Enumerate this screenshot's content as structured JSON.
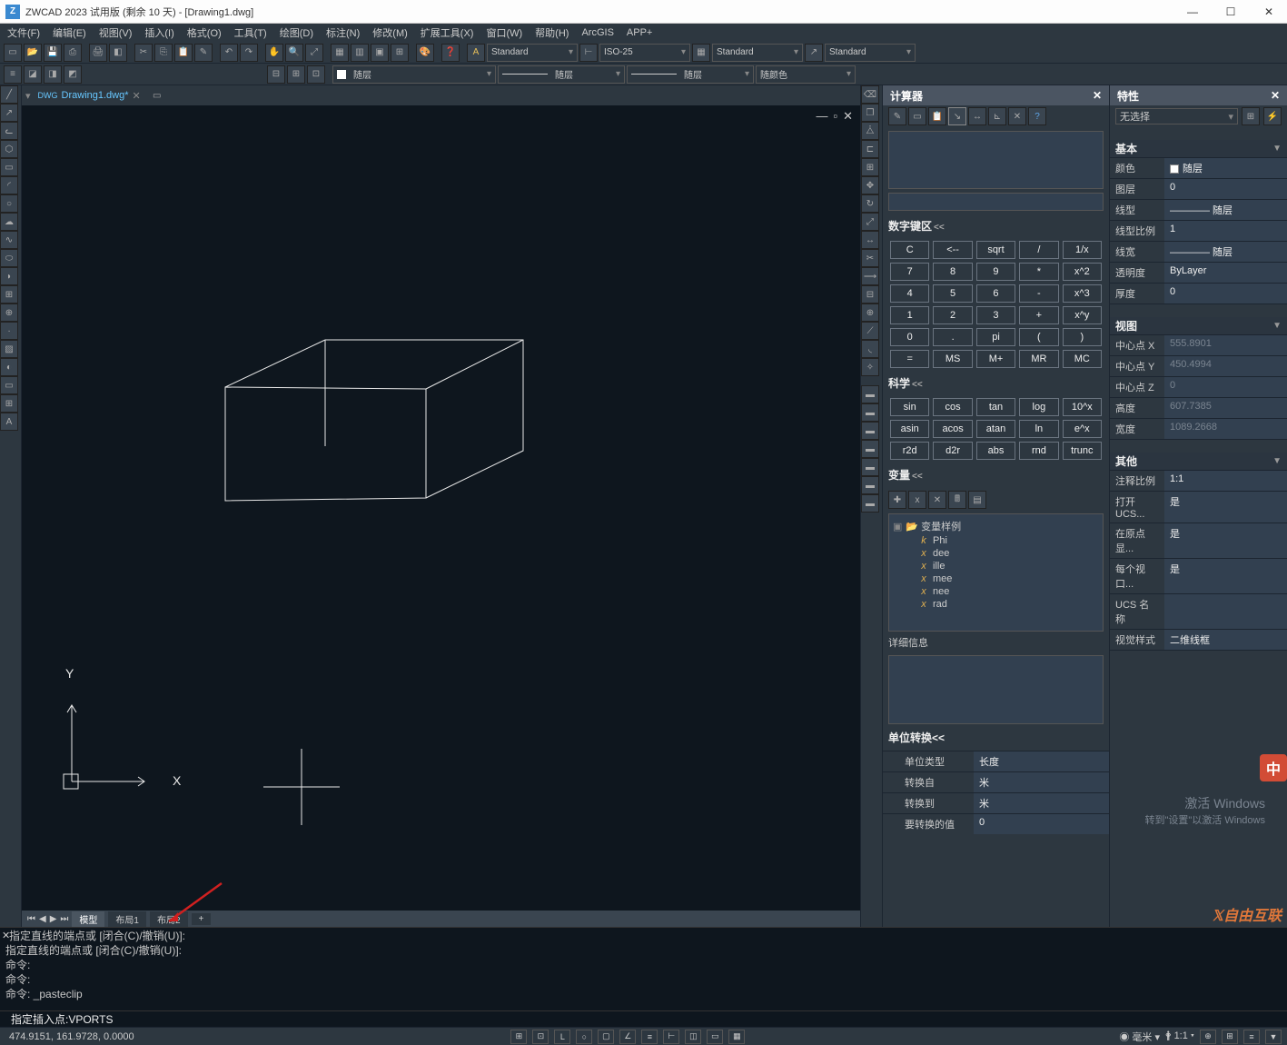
{
  "title": "ZWCAD 2023 试用版 (剩余 10 天) - [Drawing1.dwg]",
  "menu": [
    "文件(F)",
    "编辑(E)",
    "视图(V)",
    "插入(I)",
    "格式(O)",
    "工具(T)",
    "绘图(D)",
    "标注(N)",
    "修改(M)",
    "扩展工具(X)",
    "窗口(W)",
    "帮助(H)",
    "ArcGIS",
    "APP+"
  ],
  "styleCombos": {
    "text": "Standard",
    "dim": "ISO-25",
    "table": "Standard",
    "mleader": "Standard"
  },
  "layerRow": {
    "layer": "随层",
    "linetype": "随层",
    "lineweight": "随层",
    "color": "随颜色"
  },
  "docTabs": {
    "active": "Drawing1.dwg*"
  },
  "layoutTabs": [
    "模型",
    "布局1",
    "布局2"
  ],
  "calc": {
    "title": "计算器",
    "sections": {
      "numpad": "数字键区",
      "sci": "科学",
      "vars": "变量",
      "unit": "单位转换"
    },
    "keys": [
      [
        "C",
        "<--",
        "sqrt",
        "/",
        "1/x"
      ],
      [
        "7",
        "8",
        "9",
        "*",
        "x^2"
      ],
      [
        "4",
        "5",
        "6",
        "-",
        "x^3"
      ],
      [
        "1",
        "2",
        "3",
        "+",
        "x^y"
      ],
      [
        "0",
        ".",
        "pi",
        "(",
        ")"
      ],
      [
        "=",
        "MS",
        "M+",
        "MR",
        "MC"
      ]
    ],
    "sciKeys": [
      [
        "sin",
        "cos",
        "tan",
        "log",
        "10^x"
      ],
      [
        "asin",
        "acos",
        "atan",
        "ln",
        "e^x"
      ],
      [
        "r2d",
        "d2r",
        "abs",
        "rnd",
        "trunc"
      ]
    ],
    "varRoot": "变量样例",
    "vars": [
      "Phi",
      "dee",
      "ille",
      "mee",
      "nee",
      "rad"
    ],
    "detailLabel": "详细信息",
    "unitRows": {
      "type": {
        "label": "单位类型",
        "value": "长度"
      },
      "from": {
        "label": "转换自",
        "value": "米"
      },
      "to": {
        "label": "转换到",
        "value": "米"
      },
      "val": {
        "label": "要转换的值",
        "value": "0"
      }
    }
  },
  "props": {
    "title": "特性",
    "selection": "无选择",
    "groups": {
      "basic": {
        "label": "基本",
        "rows": [
          {
            "k": "颜色",
            "v": "随层",
            "swatch": true
          },
          {
            "k": "图层",
            "v": "0"
          },
          {
            "k": "线型",
            "v": "———— 随层"
          },
          {
            "k": "线型比例",
            "v": "1"
          },
          {
            "k": "线宽",
            "v": "———— 随层"
          },
          {
            "k": "透明度",
            "v": "ByLayer"
          },
          {
            "k": "厚度",
            "v": "0"
          }
        ]
      },
      "view": {
        "label": "视图",
        "rows": [
          {
            "k": "中心点 X",
            "v": "555.8901",
            "ro": true
          },
          {
            "k": "中心点 Y",
            "v": "450.4994",
            "ro": true
          },
          {
            "k": "中心点 Z",
            "v": "0",
            "ro": true
          },
          {
            "k": "高度",
            "v": "607.7385",
            "ro": true
          },
          {
            "k": "宽度",
            "v": "1089.2668",
            "ro": true
          }
        ]
      },
      "other": {
        "label": "其他",
        "rows": [
          {
            "k": "注释比例",
            "v": "1:1"
          },
          {
            "k": "打开 UCS...",
            "v": "是"
          },
          {
            "k": "在原点显...",
            "v": "是"
          },
          {
            "k": "每个视口...",
            "v": "是"
          },
          {
            "k": "UCS 名称",
            "v": ""
          },
          {
            "k": "视觉样式",
            "v": "二维线框"
          }
        ]
      }
    }
  },
  "cmdHistory": [
    "指定直线的端点或 [闭合(C)/撤销(U)]:",
    "指定直线的端点或 [闭合(C)/撤销(U)]:",
    "命令:",
    "命令:",
    "命令: _pasteclip"
  ],
  "cmdPrompt": "指定插入点: ",
  "cmdInput": "VPORTS",
  "status": {
    "coords": "474.9151, 161.9728, 0.0000",
    "scale": "毫米",
    "ratio": "1:1"
  },
  "watermark": {
    "line1": "激活 Windows",
    "line2": "转到\"设置\"以激活 Windows"
  },
  "brand": "自由互联",
  "ime": "中"
}
